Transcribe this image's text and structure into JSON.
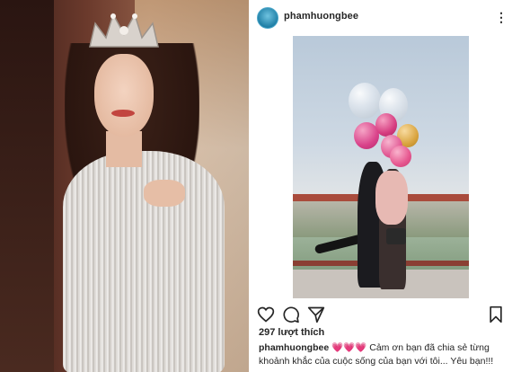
{
  "post": {
    "username": "phamhuongbee",
    "more_icon": "more-horizontal-icon",
    "more_glyph": "⋮",
    "likes_text": "297 lượt thích",
    "caption": {
      "username": "phamhuongbee",
      "hearts": "💗💗💗",
      "text_line1": " Cảm ơn bạn đã chia sẻ từng",
      "text_line2": "khoảnh khắc của cuộc sống của bạn với tôi... Yêu bạn!!!"
    },
    "actions": {
      "like_icon": "heart-icon",
      "comment_icon": "comment-icon",
      "share_icon": "send-icon",
      "save_icon": "bookmark-icon"
    }
  },
  "colors": {
    "text": "#262626",
    "avatar_ring": "#4aa6c9"
  }
}
